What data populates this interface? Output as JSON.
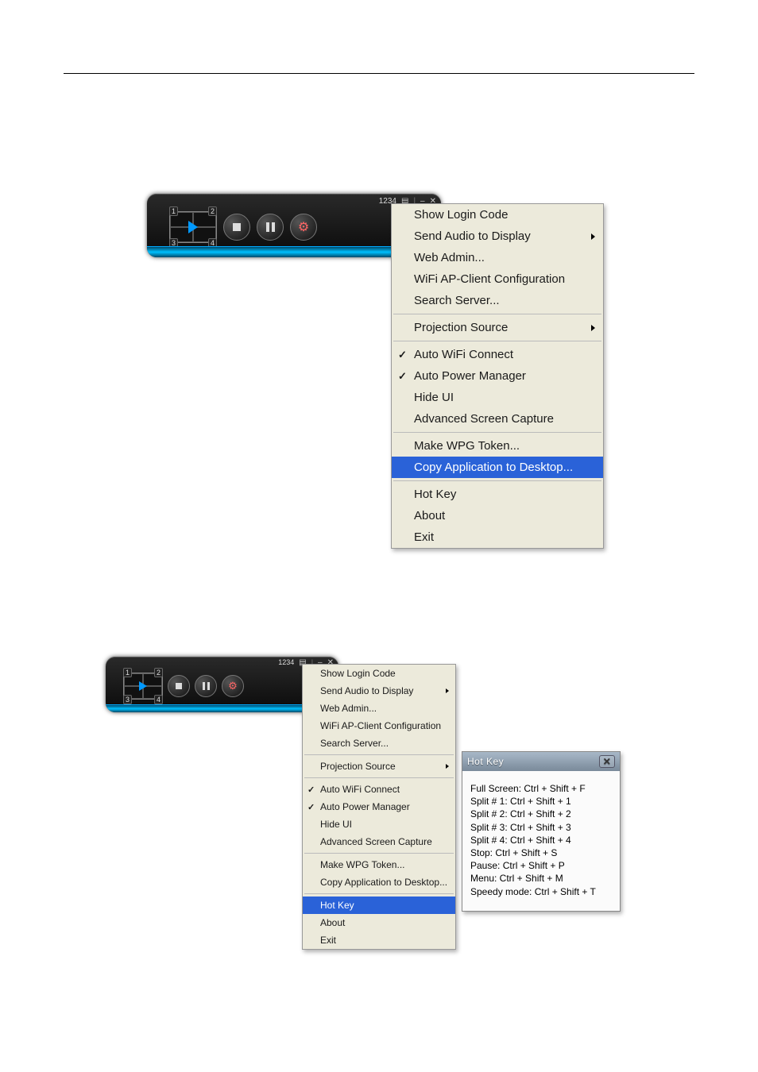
{
  "player": {
    "title_code": "1234",
    "quad": {
      "n1": "1",
      "n2": "2",
      "n3": "3",
      "n4": "4"
    }
  },
  "menu": {
    "show_login_code": "Show Login Code",
    "send_audio": "Send Audio to Display",
    "web_admin": "Web Admin...",
    "wifi_ap": "WiFi AP-Client Configuration",
    "search_server": "Search Server...",
    "projection_source": "Projection Source",
    "auto_wifi": "Auto WiFi Connect",
    "auto_power": "Auto Power Manager",
    "hide_ui": "Hide UI",
    "adv_capture": "Advanced Screen Capture",
    "make_token": "Make WPG Token...",
    "copy_app": "Copy Application to Desktop...",
    "hot_key": "Hot Key",
    "about": "About",
    "exit": "Exit"
  },
  "hotkey_dialog": {
    "title": "Hot Key",
    "lines": {
      "l1": "Full Screen: Ctrl + Shift + F",
      "l2": "Split # 1: Ctrl + Shift + 1",
      "l3": "Split # 2: Ctrl + Shift + 2",
      "l4": "Split # 3: Ctrl + Shift + 3",
      "l5": "Split # 4: Ctrl + Shift + 4",
      "l6": "Stop:  Ctrl + Shift + S",
      "l7": "Pause:  Ctrl + Shift + P",
      "l8": "Menu: Ctrl + Shift + M",
      "l9": "Speedy mode:  Ctrl + Shift + T"
    }
  }
}
